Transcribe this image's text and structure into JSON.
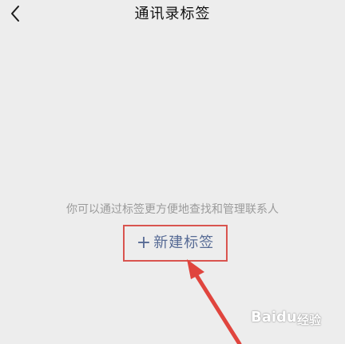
{
  "nav": {
    "title": "通讯录标签",
    "back_icon": "chevron-left-icon"
  },
  "content": {
    "hint": "你可以通过标签更方便地查找和管理联系人",
    "new_tag_plus": "+",
    "new_tag_label": "新建标签"
  },
  "colors": {
    "background": "#ededed",
    "link": "#576b95",
    "annotation": "#d9544f"
  },
  "watermark": {
    "brand": "Baidu",
    "suffix": "经验"
  }
}
